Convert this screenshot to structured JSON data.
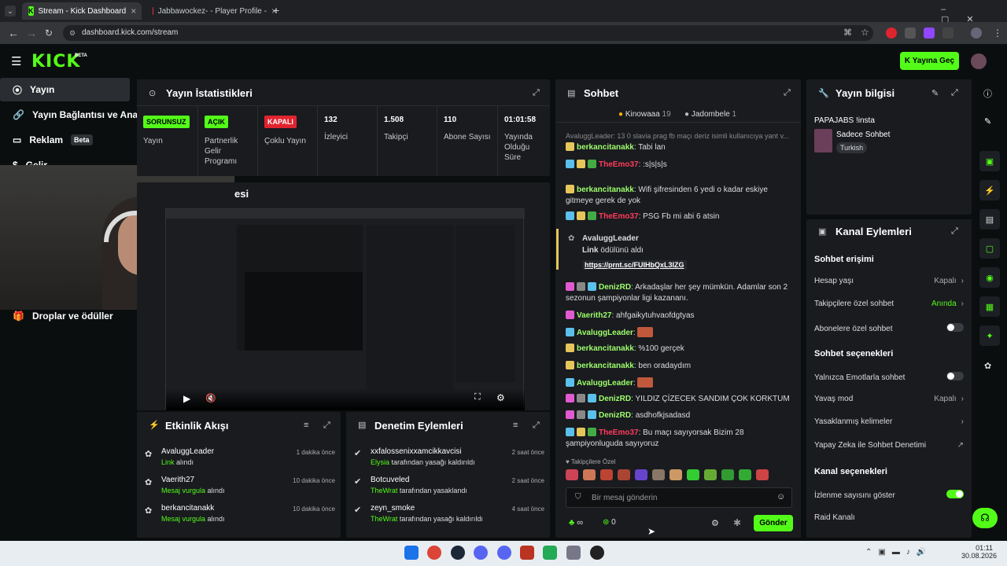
{
  "browser": {
    "tabs": [
      {
        "label": "Stream - Kick Dashboard",
        "active": true
      },
      {
        "label": "Jabbawockez- - Player Profile -",
        "active": false
      }
    ],
    "url": "dashboard.kick.com/stream"
  },
  "header": {
    "logo": "KICK",
    "beta": "BETA",
    "go_live": "Yayına Geç"
  },
  "sidebar": {
    "items": [
      {
        "label": "Yayın"
      },
      {
        "label": "Yayın Bağlantısı ve Anahtar"
      },
      {
        "label": "Reklam",
        "badge": "Beta"
      },
      {
        "label": "Gelir"
      }
    ],
    "drops": "Droplar ve ödüller"
  },
  "stats": {
    "title": "Yayın İstatistikleri",
    "cells": [
      {
        "badge": "SORUNSUZ",
        "label": "Yayın"
      },
      {
        "badge": "AÇIK",
        "label": "Partnerlik Gelir Programı"
      },
      {
        "badge": "KAPALI",
        "label": "Çoklu Yayın"
      },
      {
        "value": "132",
        "label": "İzleyici"
      },
      {
        "value": "1.508",
        "label": "Takipçi"
      },
      {
        "value": "110",
        "label": "Abone Sayısı"
      },
      {
        "value": "01:01:58",
        "label": "Yayında Olduğu Süre"
      }
    ]
  },
  "preview": {
    "title_partial": "esi"
  },
  "activity": {
    "title": "Etkinlik Akışı",
    "items": [
      {
        "user": "AvaluggLeader",
        "action_em": "Link",
        "action": " alındı",
        "time": "1 dakika önce"
      },
      {
        "user": "Vaerith27",
        "action_em": "Mesaj vurgula",
        "action": " alındı",
        "time": "10 dakika önce"
      },
      {
        "user": "berkancitanakk",
        "action_em": "Mesaj vurgula",
        "action": " alındı",
        "time": "10 dakika önce"
      }
    ]
  },
  "moderation": {
    "title": "Denetim Eylemleri",
    "items": [
      {
        "user": "xxfalossenixxamcikkavcisi",
        "by": "Elysia",
        "action": " tarafından yasağı kaldırıldı",
        "time": "2 saat önce"
      },
      {
        "user": "Botcuveled",
        "by": "TheWrat",
        "action": " tarafından yasaklandı",
        "time": "2 saat önce"
      },
      {
        "user": "zeyn_smoke",
        "by": "TheWrat",
        "action": " tarafından yasağı kaldırıldı",
        "time": "4 saat önce"
      }
    ]
  },
  "chat": {
    "title": "Sohbet",
    "top1": {
      "name": "Kinowaaa",
      "count": "19"
    },
    "top2": {
      "name": "Jadombele",
      "count": "1"
    },
    "system_line": "AvaluggLeader: 13 0 slavia prag fb maçı deriz isimli kullanıcıya yant v...",
    "messages": [
      {
        "user": "berkancitanakk",
        "color": "#9eff6b",
        "text": "Tabi lan"
      },
      {
        "user": "TheEmo37",
        "color": "#ff3b5c",
        "text": ":s|s|s|s"
      },
      {
        "user": "berkancitanakk",
        "color": "#9eff6b",
        "text": "Wifi şifresinden 6 yedi o kadar eskiye gitmeye gerek de yok"
      },
      {
        "user": "TheEmo37",
        "color": "#ff3b5c",
        "text": "PSG Fb mi abi 6 atsin"
      },
      {
        "user": "DenizRD",
        "color": "#9eff6b",
        "text": "Arkadaşlar her şey mümkün. Adamlar son 2 sezonun şampiyonlar ligi kazananı."
      },
      {
        "user": "Vaerith27",
        "color": "#9eff6b",
        "text": "ahfgaikytuhvaofdgtyas"
      },
      {
        "user": "AvaluggLeader",
        "color": "#9eff6b",
        "text": ""
      },
      {
        "user": "berkancitanakk",
        "color": "#9eff6b",
        "text": "%100 gerçek"
      },
      {
        "user": "berkancitanakk",
        "color": "#9eff6b",
        "text": "ben oradaydım"
      },
      {
        "user": "AvaluggLeader",
        "color": "#9eff6b",
        "text": ""
      },
      {
        "user": "DenizRD",
        "color": "#9eff6b",
        "text": "YILDIZ ÇİZECEK SANDIM ÇOK KORKTUM"
      },
      {
        "user": "DenizRD",
        "color": "#9eff6b",
        "text": "asdhofkjsadasd"
      },
      {
        "user": "TheEmo37",
        "color": "#ff3b5c",
        "text": "Bu maçı sayıyorsak Bizim 28 şampiyonluguda sayıyoruz"
      }
    ],
    "reward": {
      "user": "AvaluggLeader",
      "title_em": "Link",
      "title": " ödülünü aldı",
      "link": "https://prnt.sc/FUIHbQxL3IZG"
    },
    "follower_only": "Takipçilere Özel",
    "placeholder": "Bir mesaj gönderin",
    "infinity": "∞",
    "zero": "0",
    "send": "Gönder"
  },
  "stream_info": {
    "title": "Yayın bilgisi",
    "name": "PAPAJABS !insta",
    "category": "Sadece Sohbet",
    "language": "Turkish"
  },
  "channel_actions": {
    "title": "Kanal Eylemleri",
    "sec1": "Sohbet erişimi",
    "account_age": "Hesap yaşı",
    "account_age_val": "Kapalı",
    "followers_chat": "Takipçilere özel sohbet",
    "followers_chat_val": "Anında",
    "subs_chat": "Abonelere özel sohbet",
    "sec2": "Sohbet seçenekleri",
    "emote_only": "Yalnızca Emotlarla sohbet",
    "slow_mode": "Yavaş mod",
    "slow_mode_val": "Kapalı",
    "banned_words": "Yasaklanmış kelimeler",
    "ai_mod": "Yapay Zeka ile Sohbet Denetimi",
    "sec3": "Kanal seçenekleri",
    "show_viewers": "İzlenme sayısını göster",
    "raid": "Raid Kanalı"
  },
  "taskbar": {
    "time": "01:11",
    "date": "30.08.2026"
  }
}
